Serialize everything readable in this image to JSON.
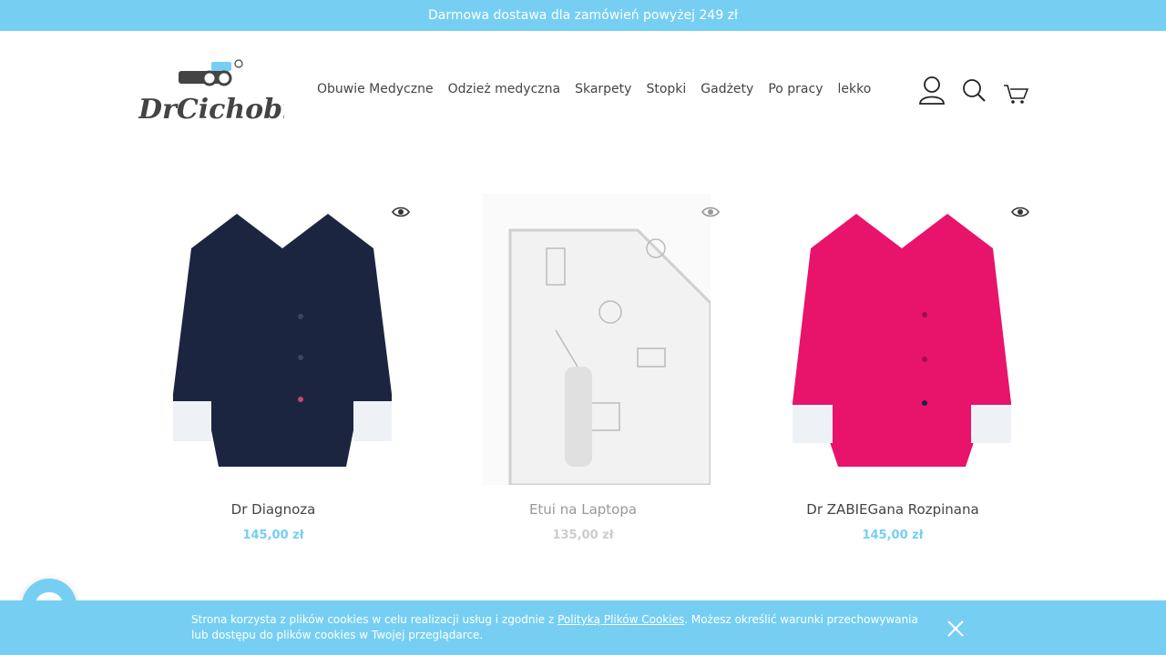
{
  "promo": {
    "text": "Darmowa dostawa dla zamówień powyżej 249 zł"
  },
  "brand": {
    "logo_text": "DrCichobieg",
    "accent": "#76cff3"
  },
  "nav": {
    "items": [
      {
        "label": "Obuwie Medyczne"
      },
      {
        "label": "Odzież medyczna"
      },
      {
        "label": "Skarpety"
      },
      {
        "label": "Stopki"
      },
      {
        "label": "Gadżety"
      },
      {
        "label": "Po pracy"
      },
      {
        "label": "lekko"
      }
    ]
  },
  "header_icons": [
    "user-icon",
    "search-icon",
    "cart-icon"
  ],
  "products": [
    {
      "name": "Dr Diagnoza",
      "price": "145,00 zł",
      "color": "#1c2540"
    },
    {
      "name": "Etui na Laptopa",
      "price": "135,00 zł",
      "color": "#e6e6e6"
    },
    {
      "name": "Dr ZABIEGana Rozpinana",
      "price": "145,00 zł",
      "color": "#e8136b"
    }
  ],
  "cookie": {
    "text_before": "Strona korzysta z plików cookies w celu realizacji usług i zgodnie z ",
    "link": "Polityką Plików Cookies",
    "text_after": ". Możesz określić warunki przechowywania lub dostępu do plików cookies w Twojej przeglądarce."
  }
}
